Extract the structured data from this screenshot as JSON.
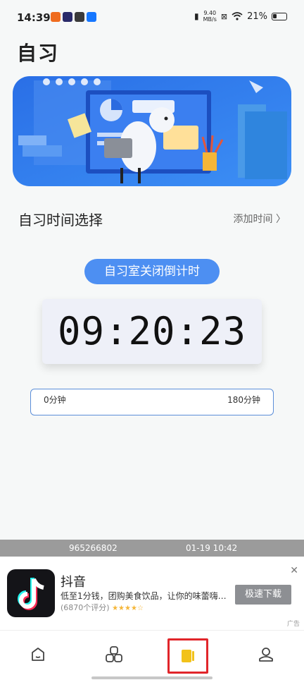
{
  "status_bar": {
    "time": "14:39",
    "net_speed_top": "9.40",
    "net_speed_bottom": "MB/s",
    "battery": "21%"
  },
  "page": {
    "title": "自习"
  },
  "section": {
    "title": "自习时间选择",
    "add_time": "添加时间 〉"
  },
  "countdown": {
    "label": "自习室关闭倒计时",
    "value": "09:20:23"
  },
  "range": {
    "min_label": "0分钟",
    "max_label": "180分钟"
  },
  "info_bar": {
    "id": "965266802",
    "datetime": "01-19 10:42"
  },
  "ad": {
    "app_name": "抖音",
    "description": "低至1分钱，团购美食饮品，让你的味蕾嗨…",
    "rating_text": "(6870个评分)",
    "stars": "★★★★☆",
    "download_label": "极速下载",
    "ad_tag": "广告",
    "close_glyph": "✕"
  },
  "tabs": [
    {
      "icon": "home-icon"
    },
    {
      "icon": "apps-icon"
    },
    {
      "icon": "study-book-icon",
      "active": true
    },
    {
      "icon": "profile-icon"
    }
  ],
  "colors": {
    "accent_blue": "#4d8ff2",
    "active_tab": "#f2c21a",
    "highlight_frame": "#e1252a"
  }
}
